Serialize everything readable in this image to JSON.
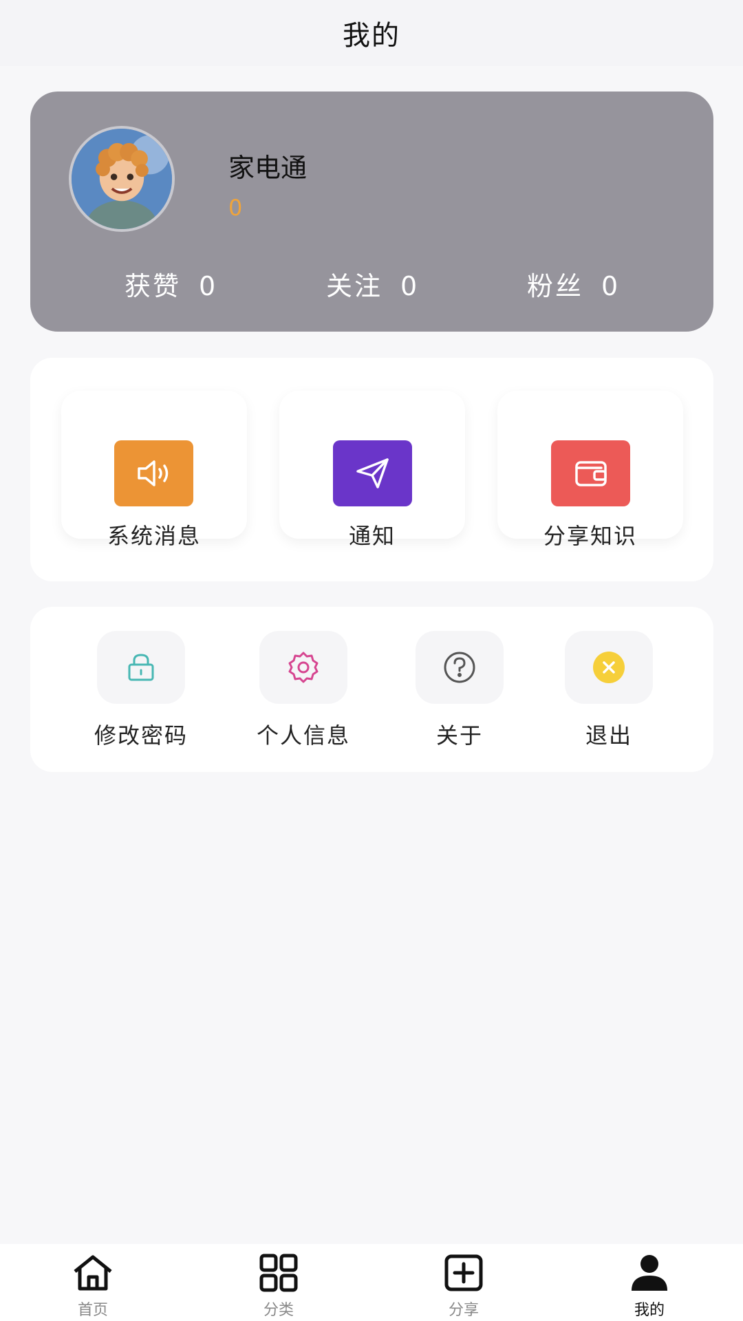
{
  "header": {
    "title": "我的"
  },
  "profile": {
    "username": "家电通",
    "sub_value": "0",
    "stats": [
      {
        "label": "获赞",
        "value": "0"
      },
      {
        "label": "关注",
        "value": "0"
      },
      {
        "label": "粉丝",
        "value": "0"
      }
    ]
  },
  "menu": {
    "items": [
      {
        "label": "系统消息",
        "icon": "speaker-icon",
        "color": "#ec9435"
      },
      {
        "label": "通知",
        "icon": "send-icon",
        "color": "#6a35c9"
      },
      {
        "label": "分享知识",
        "icon": "wallet-icon",
        "color": "#ec5a57"
      }
    ]
  },
  "tools": {
    "items": [
      {
        "label": "修改密码",
        "icon": "lock-icon",
        "color": "#47b7b3"
      },
      {
        "label": "个人信息",
        "icon": "gear-icon",
        "color": "#d64590"
      },
      {
        "label": "关于",
        "icon": "question-icon",
        "color": "#555555"
      },
      {
        "label": "退出",
        "icon": "close-icon",
        "color": "#f6cf3a"
      }
    ]
  },
  "tabbar": {
    "items": [
      {
        "label": "首页",
        "icon": "home-icon"
      },
      {
        "label": "分类",
        "icon": "grid-icon"
      },
      {
        "label": "分享",
        "icon": "plus-square-icon"
      },
      {
        "label": "我的",
        "icon": "user-icon",
        "active": true
      }
    ]
  }
}
